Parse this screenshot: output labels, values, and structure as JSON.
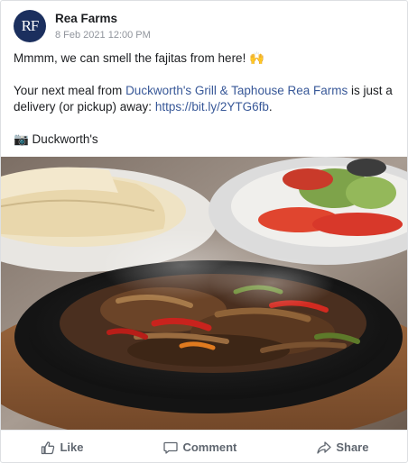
{
  "post": {
    "avatar_text": "RF",
    "page_name": "Rea Farms",
    "timestamp": "8 Feb 2021 12:00 PM",
    "line1": "Mmmm, we can smell the fajitas from here! 🙌",
    "line2_prefix": "Your next meal from ",
    "line2_link": "Duckworth's Grill & Taphouse Rea Farms",
    "line2_mid": " is just a delivery (or pickup) away: ",
    "line2_url": "https://bit.ly/2YTG6fb",
    "line2_end": ".",
    "credit": "📷 Duckworth's"
  },
  "actions": {
    "like": "Like",
    "comment": "Comment",
    "share": "Share"
  },
  "colors": {
    "link": "#385898",
    "avatar_bg": "#1b2f5e",
    "action_text": "#606770"
  }
}
